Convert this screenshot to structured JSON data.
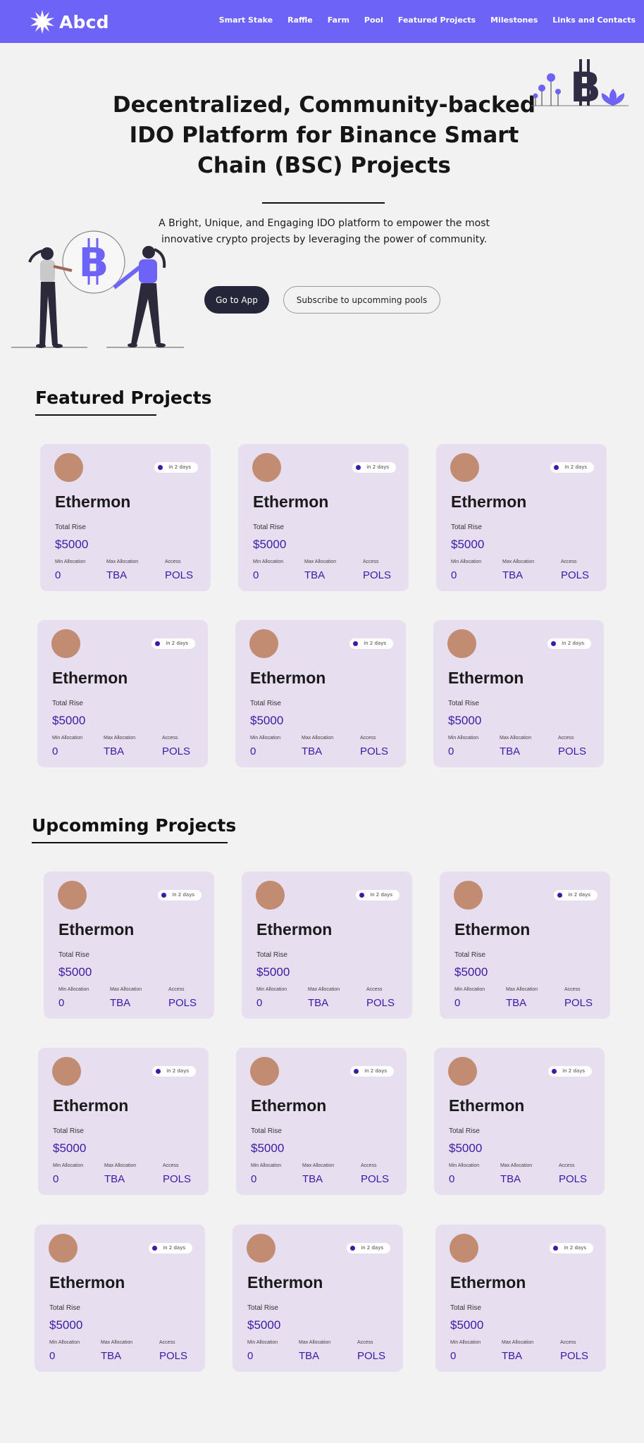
{
  "nav": {
    "brand": "Abcd",
    "links": [
      "Smart Stake",
      "Raffle",
      "Farm",
      "Pool",
      "Featured Projects",
      "Milestones",
      "Links and Contacts"
    ]
  },
  "hero": {
    "title": "Decentralized, Community-backed IDO Platform for Binance Smart Chain (BSC) Projects",
    "subtitle": "A Bright, Unique, and Engaging IDO platform to empower the most innovative crypto projects by leveraging the power of community.",
    "app_button": "Go to App",
    "subscribe_button": "Subscribe to upcomming pools"
  },
  "featured": {
    "title": "Featured Projects",
    "cards": [
      {
        "name": "Ethermon",
        "badge": "in 2 days",
        "rise_label": "Total Rise",
        "amount": "$5000",
        "min_label": "Min Allocation",
        "max_label": "Max Allocation",
        "access_label": "Access",
        "min": "0",
        "max": "TBA",
        "access": "POLS"
      },
      {
        "name": "Ethermon",
        "badge": "in 2 days",
        "rise_label": "Total Rise",
        "amount": "$5000",
        "min_label": "Min Allocation",
        "max_label": "Max Allocation",
        "access_label": "Access",
        "min": "0",
        "max": "TBA",
        "access": "POLS"
      },
      {
        "name": "Ethermon",
        "badge": "in 2 days",
        "rise_label": "Total Rise",
        "amount": "$5000",
        "min_label": "Min Allocation",
        "max_label": "Max Allocation",
        "access_label": "Access",
        "min": "0",
        "max": "TBA",
        "access": "POLS"
      },
      {
        "name": "Ethermon",
        "badge": "in 2 days",
        "rise_label": "Total Rise",
        "amount": "$5000",
        "min_label": "Min Allocation",
        "max_label": "Max Allocation",
        "access_label": "Access",
        "min": "0",
        "max": "TBA",
        "access": "POLS"
      },
      {
        "name": "Ethermon",
        "badge": "in 2 days",
        "rise_label": "Total Rise",
        "amount": "$5000",
        "min_label": "Min Allocation",
        "max_label": "Max Allocation",
        "access_label": "Access",
        "min": "0",
        "max": "TBA",
        "access": "POLS"
      },
      {
        "name": "Ethermon",
        "badge": "in 2 days",
        "rise_label": "Total Rise",
        "amount": "$5000",
        "min_label": "Min Allocation",
        "max_label": "Max Allocation",
        "access_label": "Access",
        "min": "0",
        "max": "TBA",
        "access": "POLS"
      }
    ]
  },
  "upcoming": {
    "title": "Upcomming Projects",
    "cards": [
      {
        "name": "Ethermon",
        "badge": "in 2 days",
        "rise_label": "Total Rise",
        "amount": "$5000",
        "min_label": "Min Allocation",
        "max_label": "Max Allocation",
        "access_label": "Access",
        "min": "0",
        "max": "TBA",
        "access": "POLS"
      },
      {
        "name": "Ethermon",
        "badge": "in 2 days",
        "rise_label": "Total Rise",
        "amount": "$5000",
        "min_label": "Min Allocation",
        "max_label": "Max Allocation",
        "access_label": "Access",
        "min": "0",
        "max": "TBA",
        "access": "POLS"
      },
      {
        "name": "Ethermon",
        "badge": "in 2 days",
        "rise_label": "Total Rise",
        "amount": "$5000",
        "min_label": "Min Allocation",
        "max_label": "Max Allocation",
        "access_label": "Access",
        "min": "0",
        "max": "TBA",
        "access": "POLS"
      },
      {
        "name": "Ethermon",
        "badge": "in 2 days",
        "rise_label": "Total Rise",
        "amount": "$5000",
        "min_label": "Min Allocation",
        "max_label": "Max Allocation",
        "access_label": "Access",
        "min": "0",
        "max": "TBA",
        "access": "POLS"
      },
      {
        "name": "Ethermon",
        "badge": "in 2 days",
        "rise_label": "Total Rise",
        "amount": "$5000",
        "min_label": "Min Allocation",
        "max_label": "Max Allocation",
        "access_label": "Access",
        "min": "0",
        "max": "TBA",
        "access": "POLS"
      },
      {
        "name": "Ethermon",
        "badge": "in 2 days",
        "rise_label": "Total Rise",
        "amount": "$5000",
        "min_label": "Min Allocation",
        "max_label": "Max Allocation",
        "access_label": "Access",
        "min": "0",
        "max": "TBA",
        "access": "POLS"
      },
      {
        "name": "Ethermon",
        "badge": "in 2 days",
        "rise_label": "Total Rise",
        "amount": "$5000",
        "min_label": "Min Allocation",
        "max_label": "Max Allocation",
        "access_label": "Access",
        "min": "0",
        "max": "TBA",
        "access": "POLS"
      },
      {
        "name": "Ethermon",
        "badge": "in 2 days",
        "rise_label": "Total Rise",
        "amount": "$5000",
        "min_label": "Min Allocation",
        "max_label": "Max Allocation",
        "access_label": "Access",
        "min": "0",
        "max": "TBA",
        "access": "POLS"
      },
      {
        "name": "Ethermon",
        "badge": "in 2 days",
        "rise_label": "Total Rise",
        "amount": "$5000",
        "min_label": "Min Allocation",
        "max_label": "Max Allocation",
        "access_label": "Access",
        "min": "0",
        "max": "TBA",
        "access": "POLS"
      }
    ]
  },
  "icons": {
    "brand": "sunburst-logo-icon",
    "hero_left": "people-holding-bitcoin-illustration",
    "hero_right": "bitcoin-flowers-illustration"
  },
  "colors": {
    "nav": "#6d63f6",
    "card": "#e7def0",
    "accent_text": "#3a1aa6",
    "avatar": "#c28c72",
    "primary_button": "#26263b"
  }
}
